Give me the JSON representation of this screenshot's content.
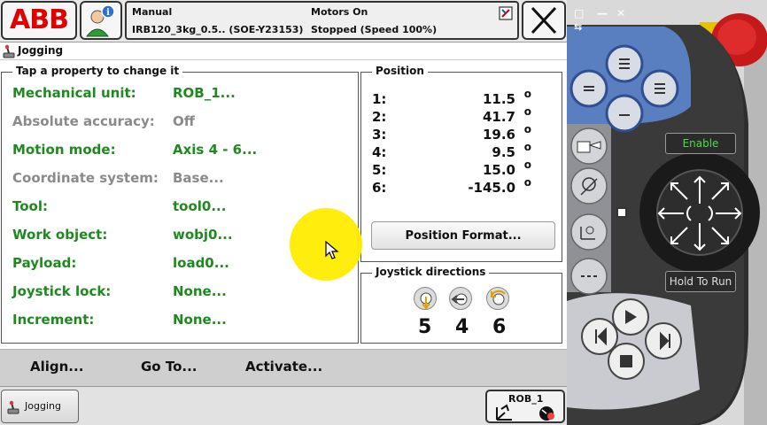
{
  "topbar": {
    "logo": "ABB",
    "mode": "Manual",
    "system": "IRB120_3kg_0.5.. (SOE-Y23153)",
    "motors": "Motors On",
    "state": "Stopped (Speed 100%)"
  },
  "header": {
    "title": "Jogging"
  },
  "properties": {
    "title": "Tap a property to change it",
    "rows": [
      {
        "label": "Mechanical unit:",
        "value": "ROB_1..."
      },
      {
        "label": "Absolute accuracy:",
        "value": "Off"
      },
      {
        "label": "Motion mode:",
        "value": "Axis 4 - 6..."
      },
      {
        "label": "Coordinate system:",
        "value": "Base..."
      },
      {
        "label": "Tool:",
        "value": "tool0..."
      },
      {
        "label": "Work object:",
        "value": "wobj0..."
      },
      {
        "label": "Payload:",
        "value": "load0..."
      },
      {
        "label": "Joystick lock:",
        "value": "None..."
      },
      {
        "label": "Increment:",
        "value": "None..."
      }
    ]
  },
  "position": {
    "title": "Position",
    "unit": "o",
    "rows": [
      {
        "axis": "1:",
        "value": "11.5"
      },
      {
        "axis": "2:",
        "value": "41.7"
      },
      {
        "axis": "3:",
        "value": "19.6"
      },
      {
        "axis": "4:",
        "value": "9.5"
      },
      {
        "axis": "5:",
        "value": "15.0"
      },
      {
        "axis": "6:",
        "value": "-145.0"
      }
    ],
    "format_button": "Position Format..."
  },
  "joystick": {
    "title": "Joystick directions",
    "axes": [
      "5",
      "4",
      "6"
    ]
  },
  "commands": {
    "align": "Align...",
    "goto": "Go To...",
    "activate": "Activate..."
  },
  "taskbar": {
    "jogging": "Jogging",
    "robot": "ROB_1"
  },
  "device": {
    "enable": "Enable",
    "hold_to_run": "Hold To Run"
  },
  "colors": {
    "brand": "#e00000",
    "active_text": "#1e8a1e",
    "inactive_text": "#8a8a8a",
    "device_blue": "#5a7fc0"
  }
}
